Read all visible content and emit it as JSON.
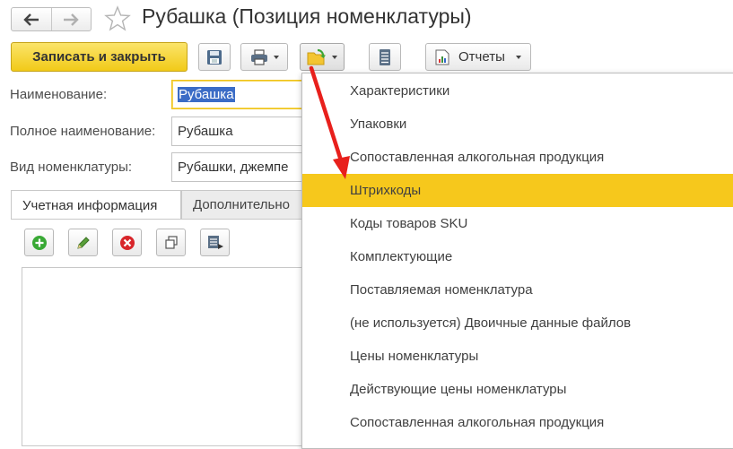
{
  "window": {
    "title": "Рубашка (Позиция номенклатуры)"
  },
  "nav": {
    "back_icon": "arrow-left-icon",
    "forward_icon": "arrow-right-icon",
    "favorite_icon": "star-icon"
  },
  "toolbar": {
    "save_close_label": "Записать и закрыть",
    "reports_label": "Отчеты",
    "accent_color": "#f1ca18"
  },
  "form": {
    "name_label": "Наименование:",
    "name_value": "Рубашка",
    "full_name_label": "Полное наименование:",
    "full_name_value": "Рубашка",
    "kind_label": "Вид номенклатуры:",
    "kind_value": "Рубашки, джемпе"
  },
  "tabs": [
    {
      "label": "Учетная информация",
      "active": true
    },
    {
      "label": "Дополнительно",
      "active": false
    }
  ],
  "menu": {
    "items": [
      {
        "label": "Характеристики",
        "highlighted": false
      },
      {
        "label": "Упаковки",
        "highlighted": false
      },
      {
        "label": "Сопоставленная алкогольная продукция",
        "highlighted": false
      },
      {
        "label": "Штрихкоды",
        "highlighted": true
      },
      {
        "label": "Коды товаров SKU",
        "highlighted": false
      },
      {
        "label": "Комплектующие",
        "highlighted": false
      },
      {
        "label": "Поставляемая номенклатура",
        "highlighted": false
      },
      {
        "label": "(не используется) Двоичные данные файлов",
        "highlighted": false
      },
      {
        "label": "Цены номенклатуры",
        "highlighted": false
      },
      {
        "label": "Действующие цены номенклатуры",
        "highlighted": false
      },
      {
        "label": "Сопоставленная алкогольная продукция",
        "highlighted": false
      }
    ],
    "highlight_color": "#f6c81c"
  },
  "annotation": {
    "arrow_color": "#e8201c"
  }
}
